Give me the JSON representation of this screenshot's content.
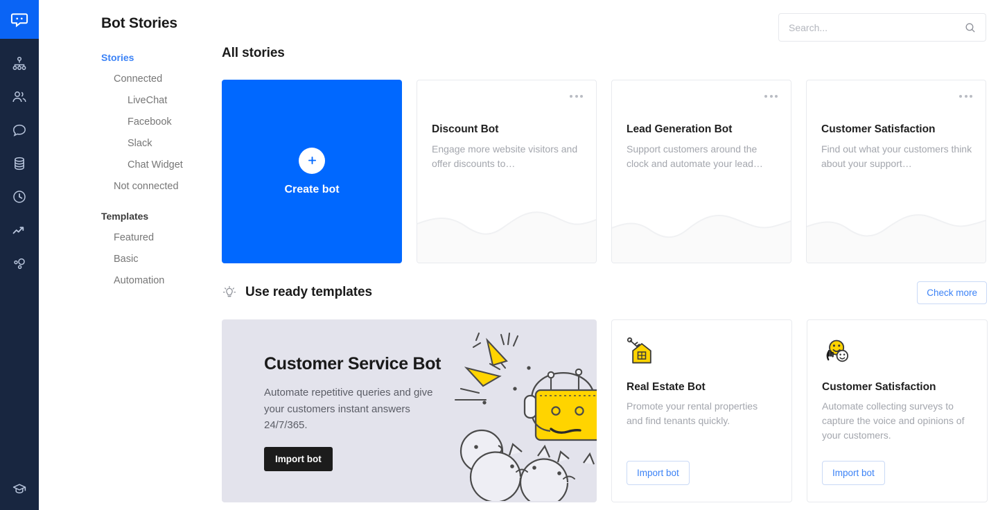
{
  "rail": {
    "logo_icon": "chat-bubble-logo",
    "items": [
      {
        "icon": "sitemap-icon",
        "name": "rail-item-sitemap"
      },
      {
        "icon": "users-icon",
        "name": "rail-item-users"
      },
      {
        "icon": "chat-icon",
        "name": "rail-item-chats"
      },
      {
        "icon": "database-icon",
        "name": "rail-item-database"
      },
      {
        "icon": "history-clock-icon",
        "name": "rail-item-history"
      },
      {
        "icon": "trending-up-icon",
        "name": "rail-item-reports"
      },
      {
        "icon": "settings-nodes-icon",
        "name": "rail-item-settings"
      }
    ],
    "bottom_icon": "graduation-cap-icon"
  },
  "page": {
    "title": "Bot Stories"
  },
  "sidebar": {
    "groups": [
      {
        "label": "Stories",
        "active": true,
        "items": [
          {
            "label": "Connected",
            "level": 1
          },
          {
            "label": "LiveChat",
            "level": 2
          },
          {
            "label": "Facebook",
            "level": 2
          },
          {
            "label": "Slack",
            "level": 2
          },
          {
            "label": "Chat Widget",
            "level": 2
          },
          {
            "label": "Not connected",
            "level": 1
          }
        ]
      },
      {
        "label": "Templates",
        "active": false,
        "items": [
          {
            "label": "Featured",
            "level": 1
          },
          {
            "label": "Basic",
            "level": 1
          },
          {
            "label": "Automation",
            "level": 1
          }
        ]
      }
    ]
  },
  "search": {
    "placeholder": "Search...",
    "value": "",
    "icon": "search-icon"
  },
  "all_stories": {
    "heading": "All stories",
    "create": {
      "label": "Create bot",
      "icon": "plus-icon"
    },
    "cards": [
      {
        "name": "Discount Bot",
        "description": "Engage more website visitors and offer discounts to…",
        "menu_icon": "more-options-icon"
      },
      {
        "name": "Lead Generation Bot",
        "description": "Support customers around the clock and automate your lead…",
        "menu_icon": "more-options-icon"
      },
      {
        "name": "Customer Satisfaction",
        "description": "Find out what your customers think about your support…",
        "menu_icon": "more-options-icon"
      }
    ]
  },
  "templates": {
    "heading": "Use ready templates",
    "heading_icon": "lightbulb-icon",
    "check_more_label": "Check more",
    "featured": {
      "title": "Customer Service Bot",
      "description": "Automate repetitive queries and give your customers instant answers 24/7/365.",
      "button_label": "Import bot",
      "illustration": "robot-with-headset-illustration"
    },
    "cards": [
      {
        "icon": "house-key-icon",
        "title": "Real Estate Bot",
        "description": "Promote your rental properties and find tenants quickly.",
        "button_label": "Import bot"
      },
      {
        "icon": "smiley-faces-icon",
        "title": "Customer Satisfaction",
        "description": "Automate collecting surveys to capture the voice and opinions of your customers.",
        "button_label": "Import bot"
      }
    ]
  },
  "colors": {
    "accent_blue": "#0068FF",
    "rail_dark": "#182640",
    "banner_bg": "#E3E3EC",
    "link_blue": "#3b82f6",
    "illustration_yellow": "#FFD400"
  }
}
